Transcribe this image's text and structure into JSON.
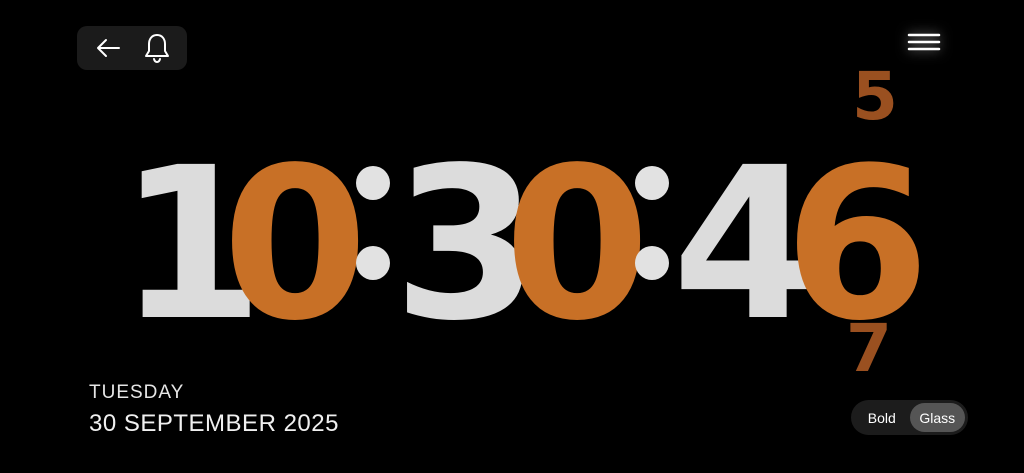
{
  "header": {
    "back_icon": "arrow-left-icon",
    "alarm_icon": "bell-icon",
    "menu_icon": "hamburger-menu-icon"
  },
  "clock": {
    "hours": [
      "1",
      "0"
    ],
    "minutes": [
      "3",
      "0"
    ],
    "seconds": [
      "4",
      "6"
    ],
    "separator": ":",
    "previous_second": "5",
    "next_second": "7",
    "colors": {
      "primary": "#dcdcdc",
      "accent": "#c87026",
      "faded_accent": "#9a5020"
    }
  },
  "date": {
    "weekday": "TUESDAY",
    "full": "30 SEPTEMBER 2025"
  },
  "style_toggle": {
    "options": [
      "Bold",
      "Glass"
    ],
    "selected": "Glass"
  }
}
